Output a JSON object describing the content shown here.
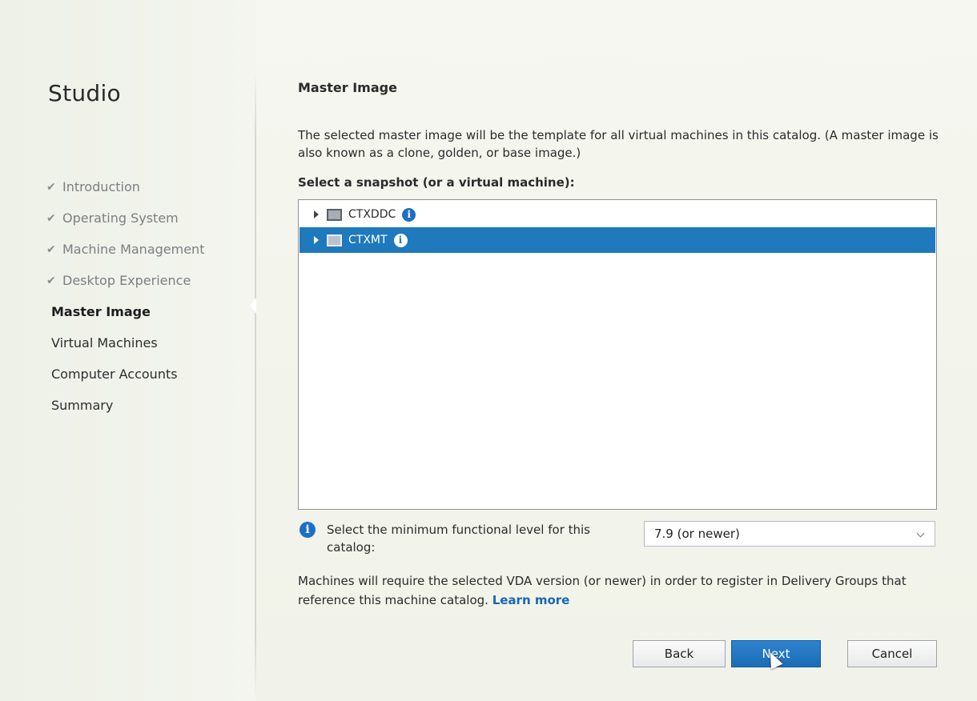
{
  "sidebar": {
    "title": "Studio",
    "steps": [
      {
        "label": "Introduction",
        "state": "done"
      },
      {
        "label": "Operating System",
        "state": "done"
      },
      {
        "label": "Machine Management",
        "state": "done"
      },
      {
        "label": "Desktop Experience",
        "state": "done"
      },
      {
        "label": "Master Image",
        "state": "current"
      },
      {
        "label": "Virtual Machines",
        "state": "pending"
      },
      {
        "label": "Computer Accounts",
        "state": "pending"
      },
      {
        "label": "Summary",
        "state": "pending"
      }
    ],
    "check_glyph": "✔"
  },
  "main": {
    "heading": "Master Image",
    "description": "The selected master image will be the template for all virtual machines in this catalog. (A master image is also known as a clone, golden, or base image.)",
    "select_label": "Select a snapshot (or a virtual machine):",
    "tree": [
      {
        "name": "CTXDDC",
        "selected": false,
        "icon": "vm-icon"
      },
      {
        "name": "CTXMT",
        "selected": true,
        "icon": "vm-icon"
      }
    ],
    "info_glyph": "i",
    "functional_level": {
      "label": "Select the minimum functional level for this catalog:",
      "value": "7.9 (or newer)"
    },
    "vda_note": "Machines will require the selected VDA version (or newer) in order to register in Delivery Groups that reference this machine catalog.",
    "learn_more": "Learn more"
  },
  "buttons": {
    "back": "Back",
    "next": "Next",
    "cancel": "Cancel"
  },
  "colors": {
    "accent": "#1f79bd",
    "link": "#1a66b8",
    "info": "#1c70c5"
  }
}
